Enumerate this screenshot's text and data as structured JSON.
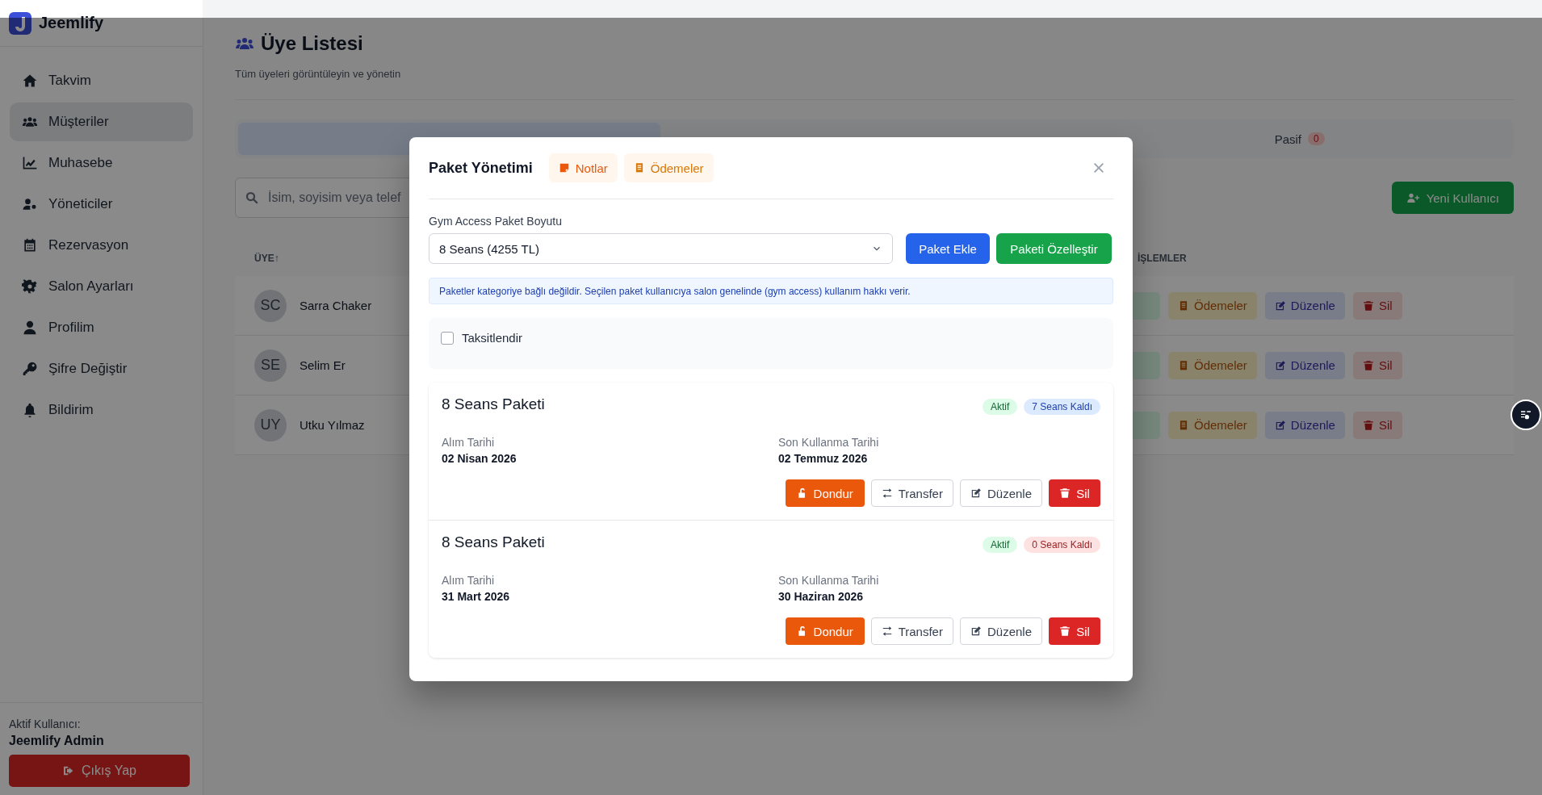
{
  "sidebar": {
    "brand": "Jeemlify",
    "items": [
      {
        "label": "Takvim",
        "selected": false
      },
      {
        "label": "Müşteriler",
        "selected": true
      },
      {
        "label": "Muhasebe",
        "selected": false
      },
      {
        "label": "Yöneticiler",
        "selected": false
      },
      {
        "label": "Rezervasyon",
        "selected": false
      },
      {
        "label": "Salon Ayarları",
        "selected": false
      },
      {
        "label": "Profilim",
        "selected": false
      },
      {
        "label": "Şifre Değiştir",
        "selected": false
      },
      {
        "label": "Bildirim",
        "selected": false
      }
    ],
    "user_label": "Aktif Kullanıcı:",
    "user_name": "Jeemlify Admin",
    "logout": "Çıkış Yap"
  },
  "header": {
    "title": "Üye Listesi",
    "subtitle": "Tüm üyeleri görüntüleyin ve yönetin"
  },
  "tabs": [
    {
      "selected": true
    },
    {
      "selected": false
    },
    {
      "label": "Pasif",
      "count": "0",
      "selected": false
    }
  ],
  "search": {
    "placeholder": "İsim, soyisim veya telef"
  },
  "new_user_button": "Yeni Kullanıcı",
  "table": {
    "columns": [
      "ÜYE↑",
      "İŞLEMLER"
    ],
    "rows": [
      {
        "initials": "SC",
        "name": "Sarra Chaker",
        "actions": [
          "Ödemeler",
          "Düzenle",
          "Sil"
        ]
      },
      {
        "initials": "SE",
        "name": "Selim Er",
        "actions": [
          "Ödemeler",
          "Düzenle",
          "Sil"
        ]
      },
      {
        "initials": "UY",
        "name": "Utku Yılmaz",
        "actions": [
          "Ödemeler",
          "Düzenle",
          "Sil"
        ]
      }
    ]
  },
  "modal": {
    "title": "Paket Yönetimi",
    "tabs": [
      "Notlar",
      "Ödemeler"
    ],
    "field_label": "Gym Access Paket Boyutu",
    "select_value": "8 Seans (4255 TL)",
    "buttons": [
      "Paket Ekle",
      "Paketi Özelleştir"
    ],
    "info": "Paketler kategoriye bağlı değildir. Seçilen paket kullanıcıya salon genelinde (gym access) kullanım hakkı verir.",
    "installment": {
      "label": "Taksitlendir",
      "checked": false
    },
    "packages": [
      {
        "name": "8 Seans Paketi",
        "status": "Aktif",
        "remaining": "7 Seans Kaldı",
        "depleted": false,
        "purchase_label": "Alım Tarihi",
        "purchase_date": "02 Nisan 2026",
        "expiry_label": "Son Kullanma Tarihi",
        "expiry_date": "02 Temmuz 2026",
        "actions": [
          "Dondur",
          "Transfer",
          "Düzenle",
          "Sil"
        ]
      },
      {
        "name": "8 Seans Paketi",
        "status": "Aktif",
        "remaining": "0 Seans Kaldı",
        "depleted": true,
        "purchase_label": "Alım Tarihi",
        "purchase_date": "31 Mart 2026",
        "expiry_label": "Son Kullanma Tarihi",
        "expiry_date": "30 Haziran 2026",
        "actions": [
          "Dondur",
          "Transfer",
          "Düzenle",
          "Sil"
        ]
      }
    ]
  }
}
